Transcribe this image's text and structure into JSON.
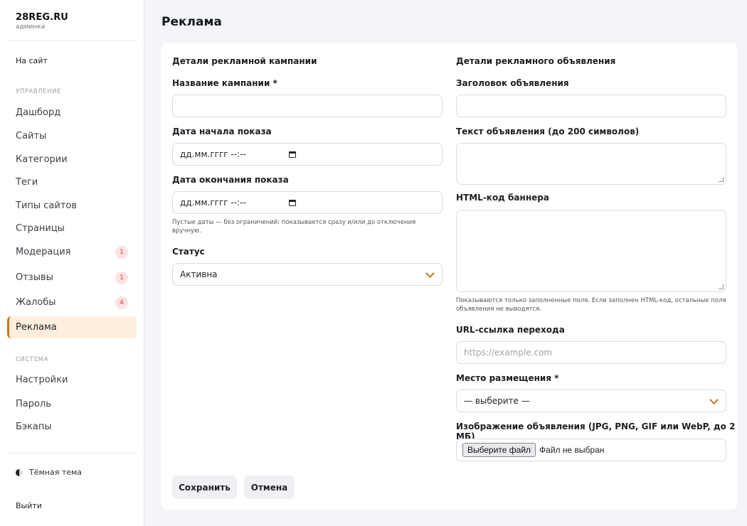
{
  "brand": {
    "name": "28REG.RU",
    "sub": "админка"
  },
  "sidebar": {
    "to_site": "На сайт",
    "section_manage": "УПРАВЛЕНИЕ",
    "manage_items": [
      {
        "label": "Дашборд"
      },
      {
        "label": "Сайты"
      },
      {
        "label": "Категории"
      },
      {
        "label": "Теги"
      },
      {
        "label": "Типы сайтов"
      },
      {
        "label": "Страницы"
      },
      {
        "label": "Модерация",
        "badge": "1"
      },
      {
        "label": "Отзывы",
        "badge": "1"
      },
      {
        "label": "Жалобы",
        "badge": "4"
      },
      {
        "label": "Реклама",
        "active": true
      }
    ],
    "section_system": "СИСТЕМА",
    "system_items": [
      {
        "label": "Настройки"
      },
      {
        "label": "Пароль"
      },
      {
        "label": "Бэкапы"
      }
    ],
    "theme_toggle": "Тёмная тема",
    "logout": "Выйти"
  },
  "page": {
    "title": "Реклама"
  },
  "campaign": {
    "heading": "Детали рекламной кампании",
    "name_label": "Название кампании *",
    "name_value": "",
    "start_label": "Дата начала показа",
    "start_value": "дд.мм.гггг --:--",
    "end_label": "Дата окончания показа",
    "end_value": "дд.мм.гггг --:--",
    "dates_hint": "Пустые даты — без ограничений: показывается сразу и/или до отключения вручную.",
    "status_label": "Статус",
    "status_value": "Активна"
  },
  "ad": {
    "heading": "Детали рекламного объявления",
    "title_label": "Заголовок объявления",
    "text_label": "Текст объявления (до 200 символов)",
    "html_label": "HTML-код баннера",
    "fields_hint": "Показываются только заполненные поля. Если заполнен HTML-код, остальные поля объявления не выводятся.",
    "url_label": "URL-ссылка перехода",
    "url_placeholder": "https://example.com",
    "placement_label": "Место размещения *",
    "placement_value": "— выберите —",
    "image_label": "Изображение объявления (JPG, PNG, GIF или WebP, до 2 МБ)",
    "file_button": "Выберите файл",
    "file_status": "Файл не выбран"
  },
  "actions": {
    "save": "Сохранить",
    "cancel": "Отмена"
  },
  "colors": {
    "accent": "#c8731f",
    "active_bg": "#fdeedd",
    "badge_bg": "#fde2e2",
    "badge_text": "#c94545"
  }
}
